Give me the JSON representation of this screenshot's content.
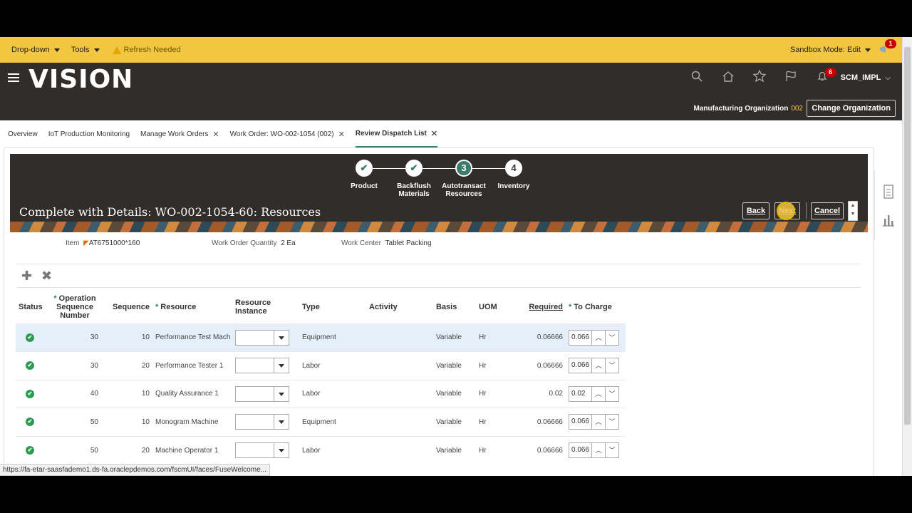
{
  "topbar": {
    "dropdown": "Drop-down",
    "tools": "Tools",
    "refresh": "Refresh Needed",
    "sandbox": "Sandbox Mode: Edit",
    "notif_count": "1"
  },
  "header": {
    "logo": "VISION",
    "user": "SCM_IMPL",
    "bell_count": "6",
    "org_label": "Manufacturing Organization",
    "org_code": "002",
    "change_org": "Change Organization"
  },
  "tabs": [
    {
      "label": "Overview",
      "closable": false
    },
    {
      "label": "IoT Production Monitoring",
      "closable": false
    },
    {
      "label": "Manage Work Orders",
      "closable": true
    },
    {
      "label": "Work Order: WO-002-1054 (002)",
      "closable": true
    },
    {
      "label": "Review Dispatch List",
      "closable": true
    }
  ],
  "train": {
    "steps": [
      {
        "label1": "Product",
        "label2": "",
        "state": "done"
      },
      {
        "label1": "Backflush",
        "label2": "Materials",
        "state": "done"
      },
      {
        "label1": "Autotransact",
        "label2": "Resources",
        "state": "current",
        "num": "3"
      },
      {
        "label1": "Inventory",
        "label2": "",
        "state": "todo",
        "num": "4"
      }
    ]
  },
  "page": {
    "title": "Complete with Details: WO-002-1054-60: Resources",
    "back": "Back",
    "next": "Next",
    "cancel": "Cancel"
  },
  "fields": {
    "item_label": "Item",
    "item_value": "AT6751000*160",
    "qty_label": "Work Order Quantity",
    "qty_value": "2 Ea",
    "wc_label": "Work Center",
    "wc_value": "Tablet Packing"
  },
  "table": {
    "headers": {
      "status": "Status",
      "op_seq": "Operation Sequence Number",
      "sequence": "Sequence",
      "resource": "Resource",
      "res_instance": "Resource Instance",
      "type": "Type",
      "activity": "Activity",
      "basis": "Basis",
      "uom": "UOM",
      "required": "Required",
      "to_charge": "To Charge"
    },
    "rows": [
      {
        "op": "30",
        "seq": "10",
        "resource": "Performance Test Mach",
        "type": "Equipment",
        "basis": "Variable",
        "uom": "Hr",
        "required": "0.06666",
        "charge": "0.066"
      },
      {
        "op": "30",
        "seq": "20",
        "resource": "Performance Tester 1",
        "type": "Labor",
        "basis": "Variable",
        "uom": "Hr",
        "required": "0.06666",
        "charge": "0.066"
      },
      {
        "op": "40",
        "seq": "10",
        "resource": "Quality Assurance 1",
        "type": "Labor",
        "basis": "Variable",
        "uom": "Hr",
        "required": "0.02",
        "charge": "0.02"
      },
      {
        "op": "50",
        "seq": "10",
        "resource": "Monogram Machine",
        "type": "Equipment",
        "basis": "Variable",
        "uom": "Hr",
        "required": "0.06666",
        "charge": "0.066"
      },
      {
        "op": "50",
        "seq": "20",
        "resource": "Machine Operator 1",
        "type": "Labor",
        "basis": "Variable",
        "uom": "Hr",
        "required": "0.06666",
        "charge": "0.066"
      }
    ]
  },
  "status_url": "https://fa-etar-saasfademo1.ds-fa.oraclepdemos.com/fscmUI/faces/FuseWelcome...",
  "colors": {
    "accent": "#3a7d6b",
    "topbar": "#f2c641",
    "header": "#312d2a",
    "ok": "#2a9d4f"
  }
}
